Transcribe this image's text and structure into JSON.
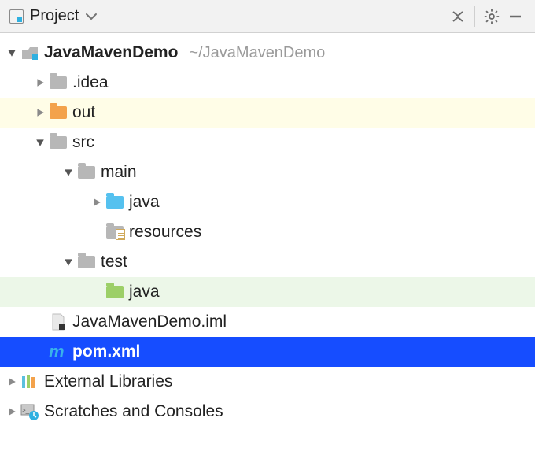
{
  "header": {
    "title": "Project"
  },
  "tree": {
    "root": {
      "name": "JavaMavenDemo",
      "path": "~/JavaMavenDemo"
    },
    "idea": ".idea",
    "out": "out",
    "src": "src",
    "main": "main",
    "main_java": "java",
    "resources": "resources",
    "test": "test",
    "test_java": "java",
    "iml": "JavaMavenDemo.iml",
    "pom": "pom.xml",
    "ext_libs": "External Libraries",
    "scratches": "Scratches and Consoles"
  }
}
